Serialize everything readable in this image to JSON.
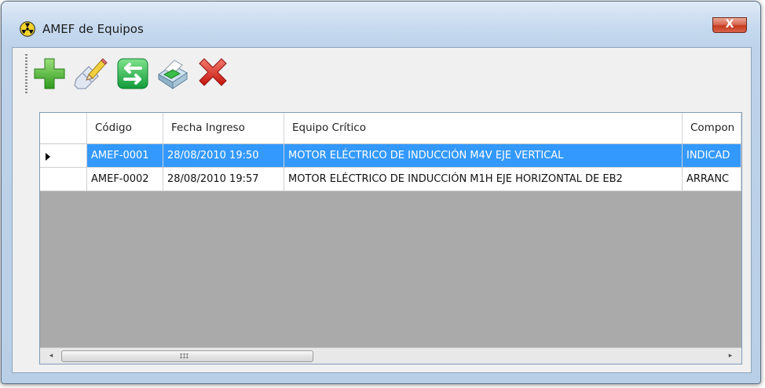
{
  "window": {
    "title": "AMEF de Equipos",
    "app_icon": "radiation-icon",
    "close_label": "X"
  },
  "toolbar": {
    "buttons": [
      {
        "name": "add-button",
        "icon": "plus-icon",
        "color": "#3aa52a"
      },
      {
        "name": "edit-button",
        "icon": "pencil-eraser-icon",
        "color": "#d7b84a"
      },
      {
        "name": "exchange-button",
        "icon": "arrows-exchange-icon",
        "color": "#2fb44f"
      },
      {
        "name": "print-button",
        "icon": "printer-icon",
        "color": "#5aa7c9"
      },
      {
        "name": "delete-button",
        "icon": "red-x-icon",
        "color": "#d8281e"
      }
    ]
  },
  "grid": {
    "columns": [
      "Código",
      "Fecha Ingreso",
      "Equipo Crítico",
      "Compon"
    ],
    "rows": [
      {
        "codigo": "AMEF-0001",
        "fecha": "28/08/2010 19:50",
        "equipo": "MOTOR ELÉCTRICO DE INDUCCIÓN M4V EJE VERTICAL",
        "componente": "INDICAD",
        "selected": true
      },
      {
        "codigo": "AMEF-0002",
        "fecha": "28/08/2010 19:57",
        "equipo": "MOTOR ELÉCTRICO DE INDUCCIÓN M1H EJE HORIZONTAL DE EB2",
        "componente": "ARRANC",
        "selected": false
      }
    ],
    "selection_color": "#3399ff",
    "empty_area_color": "#aaaaaa"
  },
  "scrollbar": {
    "left_arrow": "◂",
    "right_arrow": "▸",
    "thumb_grip": "III"
  }
}
